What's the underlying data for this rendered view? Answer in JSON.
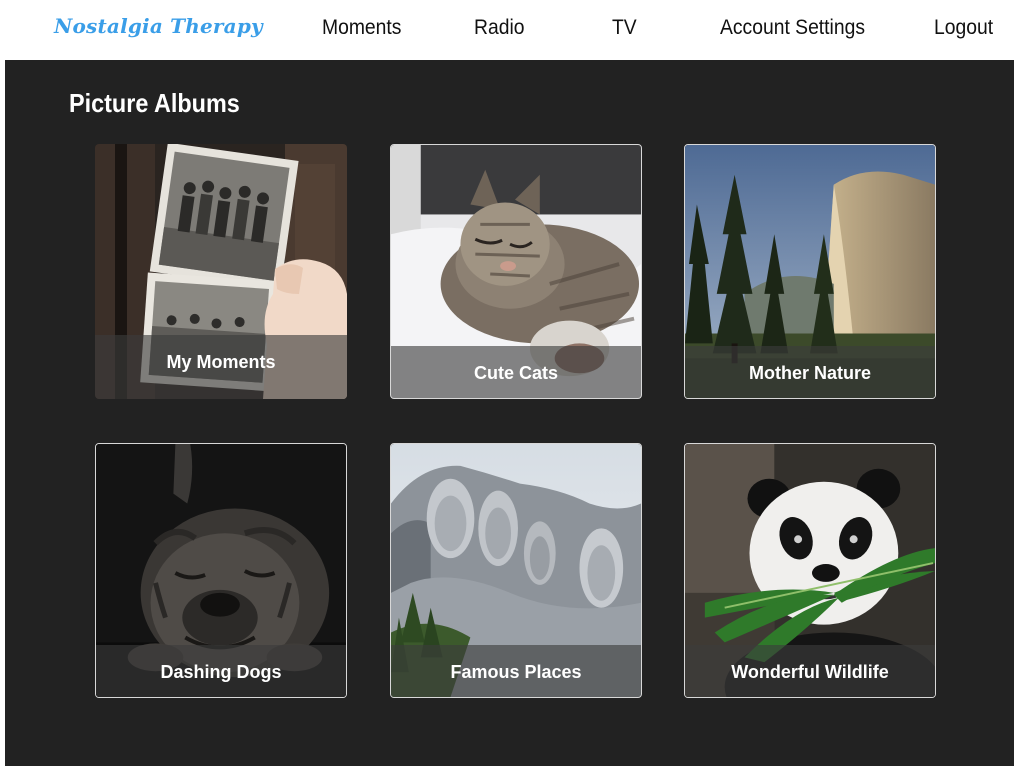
{
  "app": {
    "logo": "Nostalgia Therapy"
  },
  "nav": {
    "moments": "Moments",
    "radio": "Radio",
    "tv": "TV",
    "account_settings": "Account Settings",
    "logout": "Logout"
  },
  "page": {
    "title": "Picture Albums"
  },
  "albums": [
    {
      "label": "My Moments",
      "image": "vintage-photos-image"
    },
    {
      "label": "Cute Cats",
      "image": "sleeping-cat-image"
    },
    {
      "label": "Mother Nature",
      "image": "yosemite-landscape-image"
    },
    {
      "label": "Dashing Dogs",
      "image": "bulldog-image"
    },
    {
      "label": "Famous Places",
      "image": "mount-rushmore-image"
    },
    {
      "label": "Wonderful Wildlife",
      "image": "panda-image"
    }
  ],
  "colors": {
    "logo": "#3a9ee8",
    "background": "#222222",
    "navbar": "#ffffff"
  }
}
